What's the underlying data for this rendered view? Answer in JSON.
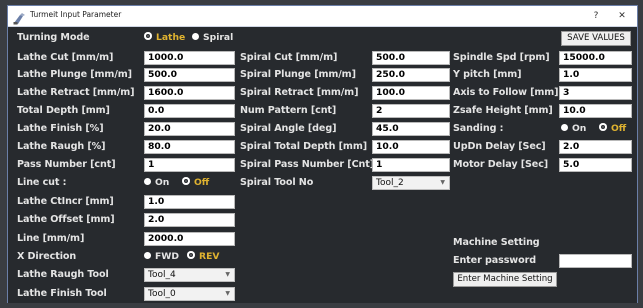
{
  "window": {
    "title": "Turmeit Input Parameter",
    "help_glyph": "?",
    "close_glyph": "✕"
  },
  "turning_mode": {
    "label": "Turning Mode",
    "options": [
      "Lathe",
      "Spiral"
    ],
    "selected": "Lathe"
  },
  "save_button": "SAVE VALUES",
  "col1": {
    "lathe_cut": {
      "label": "Lathe Cut [mm/m]",
      "value": "1000.0"
    },
    "lathe_plunge": {
      "label": "Lathe Plunge [mm/m]",
      "value": "500.0"
    },
    "lathe_retract": {
      "label": "Lathe Retract [mm/m]",
      "value": "1600.0"
    },
    "total_depth": {
      "label": "Total Depth [mm]",
      "value": "0.0"
    },
    "lathe_finish": {
      "label": "Lathe Finish [%]",
      "value": "20.0"
    },
    "lathe_raugh": {
      "label": "Lathe Raugh  [%]",
      "value": "80.0"
    },
    "pass_number": {
      "label": "Pass Number [cnt]",
      "value": "1"
    },
    "line_cut": {
      "label": "Line cut :",
      "options": [
        "On",
        "Off"
      ],
      "selected": "Off"
    },
    "lathe_ctincr": {
      "label": "Lathe CtIncr [mm]",
      "value": "1.0"
    },
    "lathe_offset": {
      "label": "Lathe Offset [mm]",
      "value": "2.0"
    },
    "line": {
      "label": "Line [mm/m]",
      "value": "2000.0"
    },
    "x_direction": {
      "label": "X Direction",
      "options": [
        "FWD",
        "REV"
      ],
      "selected": "REV"
    },
    "lathe_raugh_tool": {
      "label": "Lathe Raugh Tool",
      "value": "Tool_4"
    },
    "lathe_finish_tool": {
      "label": "Lathe Finish Tool",
      "value": "Tool_0"
    }
  },
  "col2": {
    "spiral_cut": {
      "label": "Spiral Cut [mm/m]",
      "value": "500.0"
    },
    "spiral_plunge": {
      "label": "Spiral Plunge [mm/m]",
      "value": "250.0"
    },
    "spiral_retract": {
      "label": "Spiral Retract [mm/m]",
      "value": "100.0"
    },
    "num_pattern": {
      "label": "Num Pattern [cnt]",
      "value": "2"
    },
    "spiral_angle": {
      "label": "Spiral Angle [deg]",
      "value": "45.0"
    },
    "spiral_total_depth": {
      "label": "Spiral Total Depth [mm]",
      "value": "10.0"
    },
    "spiral_pass_number": {
      "label": "Spiral Pass Number [Cnt]",
      "value": "1"
    },
    "spiral_tool_no": {
      "label": "Spiral Tool No",
      "value": "Tool_2"
    }
  },
  "col3": {
    "spindle_spd": {
      "label": "Spindle Spd [rpm]",
      "value": "15000.0"
    },
    "y_pitch": {
      "label": "Y pitch [mm]",
      "value": "1.0"
    },
    "axis_to_follow": {
      "label": "Axis to Follow [mm]",
      "value": "3"
    },
    "zsafe_height": {
      "label": "Zsafe Height [mm]",
      "value": "10.0"
    },
    "sanding": {
      "label": "Sanding :",
      "options": [
        "On",
        "Off"
      ],
      "selected": "Off"
    },
    "updn_delay": {
      "label": "UpDn Delay [Sec]",
      "value": "2.0"
    },
    "motor_delay": {
      "label": "Motor Delay [Sec]",
      "value": "5.0"
    }
  },
  "machine": {
    "heading": "Machine Setting",
    "password_label": "Enter password",
    "password_value": "",
    "enter_button": "Enter Machine Setting"
  },
  "colors": {
    "background": "#272a2e",
    "label": "#e4e4e4",
    "selected_option": "#e0b330"
  }
}
